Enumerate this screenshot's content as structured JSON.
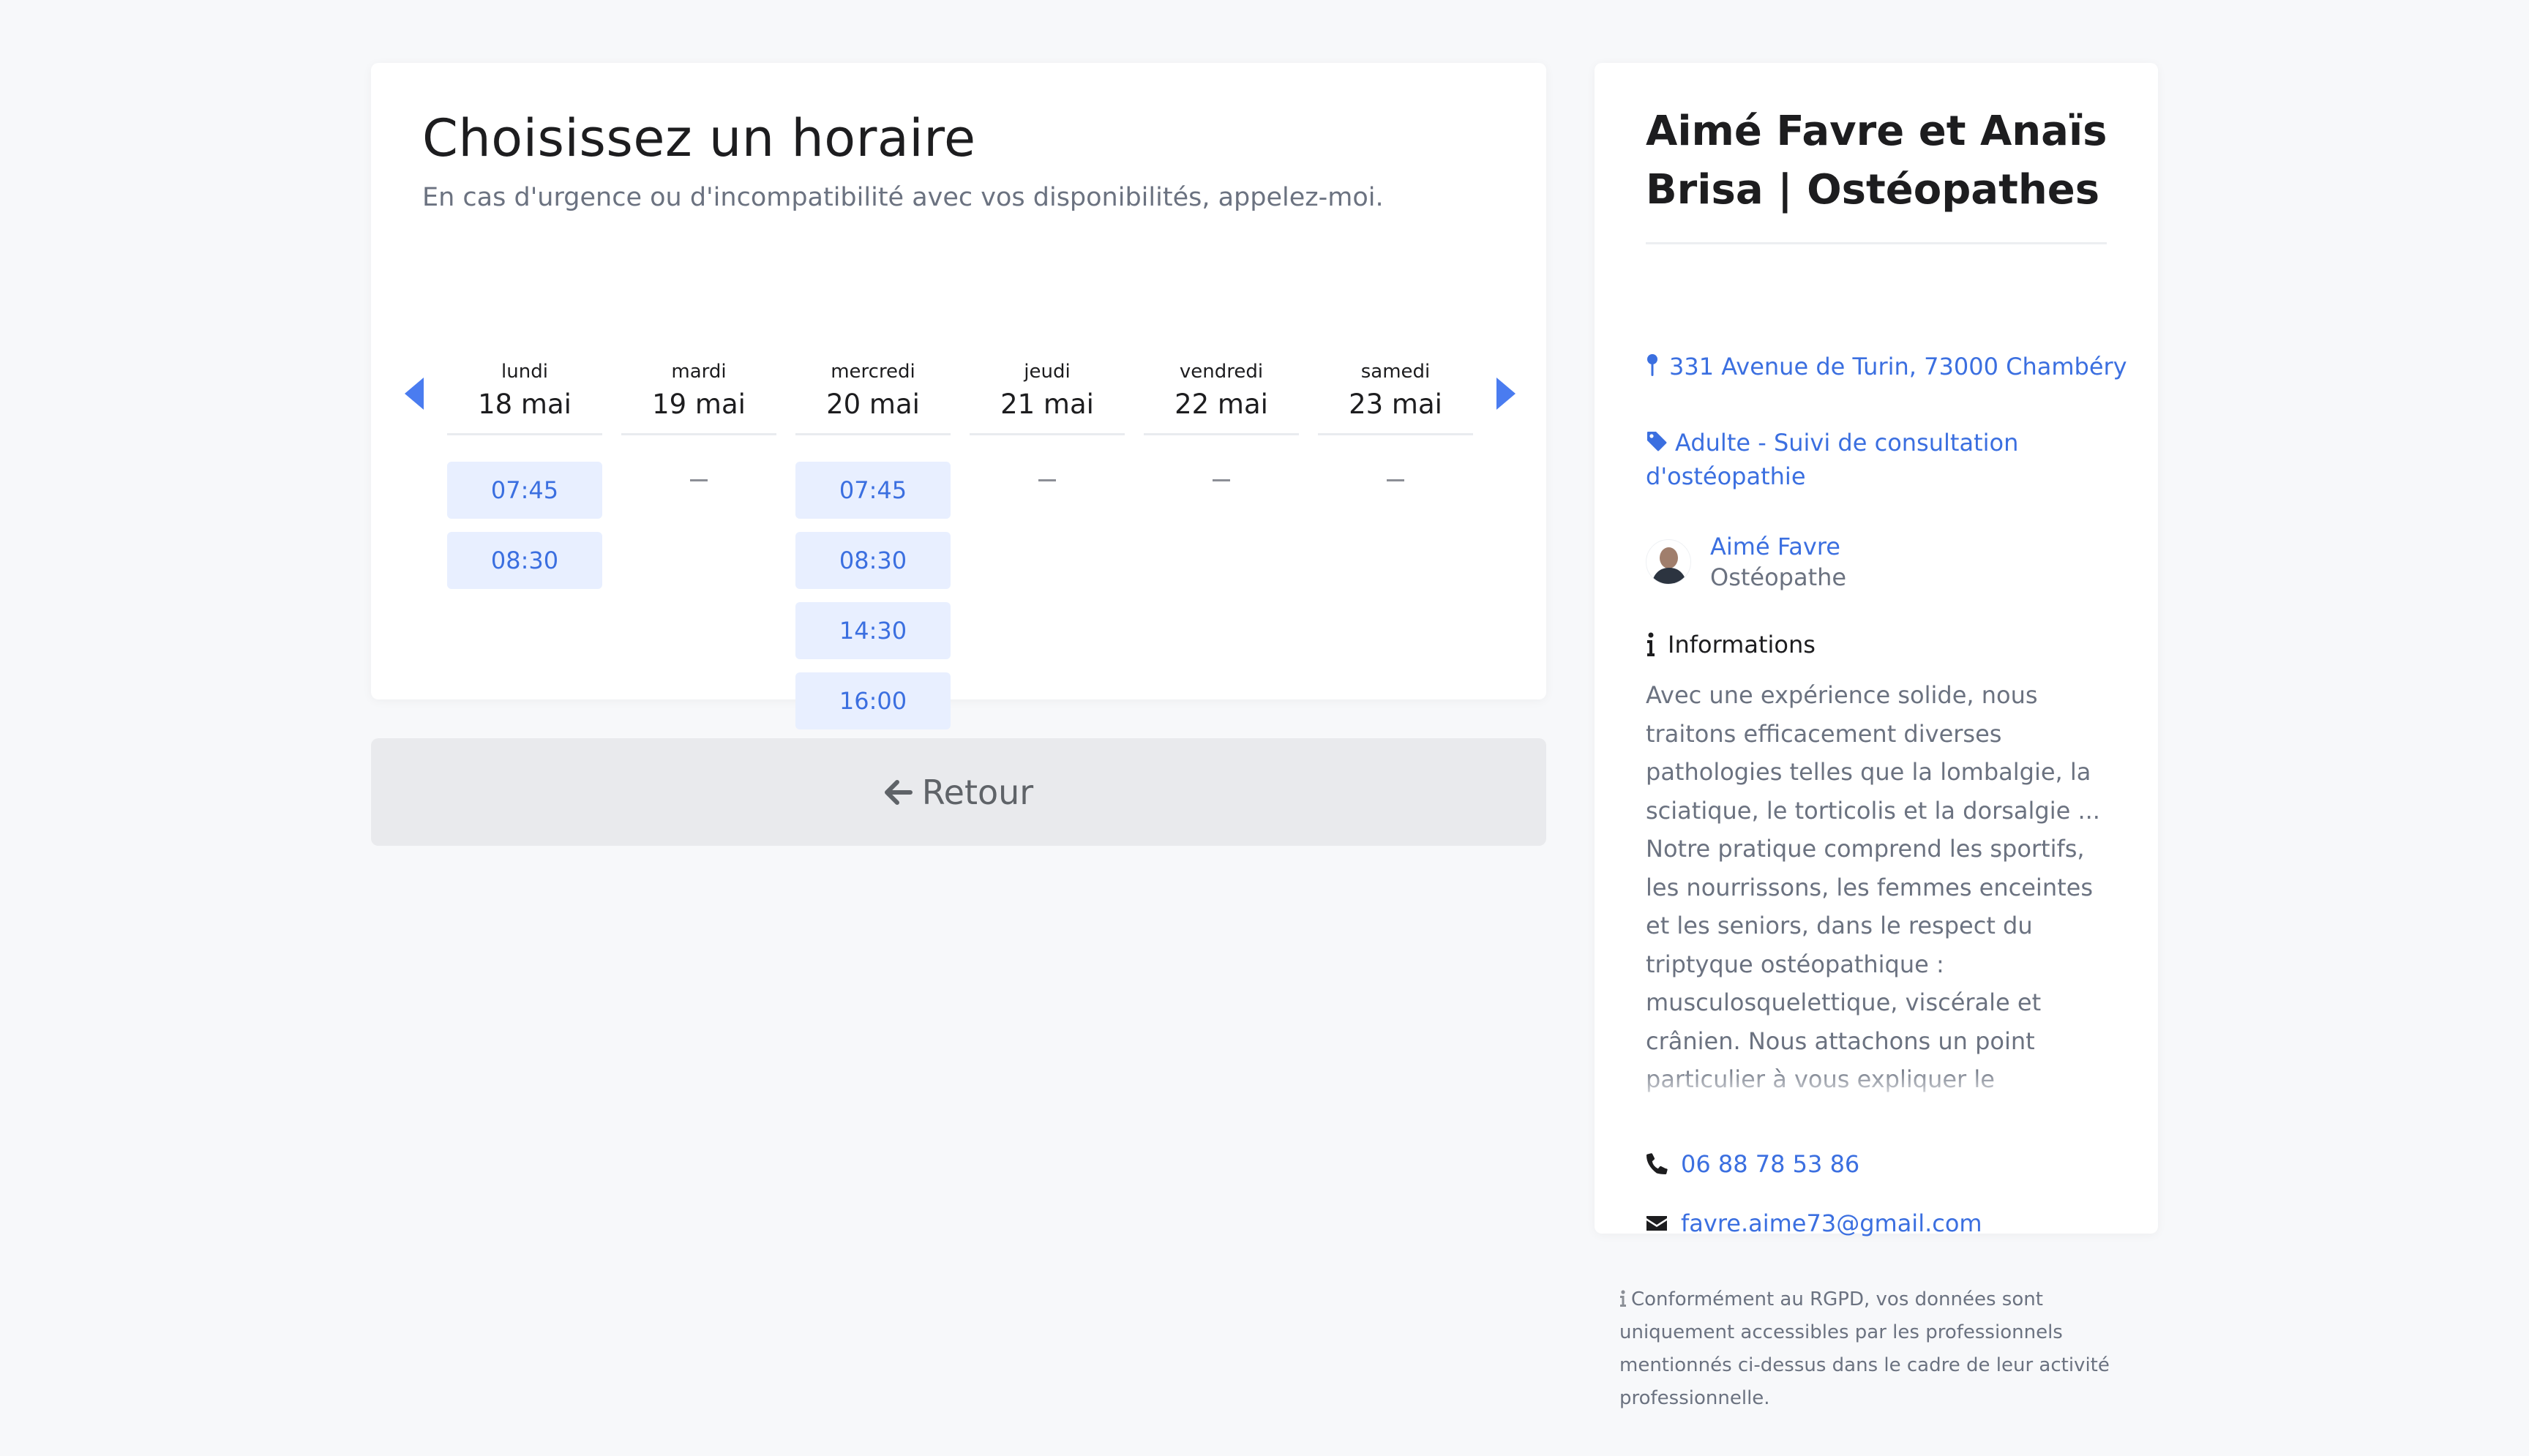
{
  "scheduler": {
    "title": "Choisissez un horaire",
    "subtitle": "En cas d'urgence ou d'incompatibilité avec vos disponibilités, appelez-moi.",
    "prev_icon": "caret-left-icon",
    "next_icon": "caret-right-icon",
    "empty_marker": "—",
    "days": [
      {
        "name": "lundi",
        "date": "18 mai",
        "slots": [
          "07:45",
          "08:30"
        ]
      },
      {
        "name": "mardi",
        "date": "19 mai",
        "slots": []
      },
      {
        "name": "mercredi",
        "date": "20 mai",
        "slots": [
          "07:45",
          "08:30",
          "14:30",
          "16:00"
        ]
      },
      {
        "name": "jeudi",
        "date": "21 mai",
        "slots": []
      },
      {
        "name": "vendredi",
        "date": "22 mai",
        "slots": []
      },
      {
        "name": "samedi",
        "date": "23 mai",
        "slots": []
      }
    ]
  },
  "back_button": {
    "label": "Retour",
    "icon": "arrow-left-icon"
  },
  "practitioner": {
    "title": "Aimé Favre et Anaïs Brisa | Ostéopathes",
    "address": "331 Avenue de Turin, 73000 Chambéry",
    "address_icon": "map-pin-icon",
    "service": "Adulte - Suivi de consultation d'ostéopathie",
    "service_icon": "tag-icon",
    "person": {
      "name": "Aimé Favre",
      "role": "Ostéopathe"
    },
    "info_heading": "Informations",
    "info_icon": "info-icon",
    "info_text": "Avec une expérience solide, nous traitons efficacement diverses pathologies telles que la lombalgie, la sciatique, le torticolis et la dorsalgie ... Notre pratique comprend les sportifs, les nourrissons, les femmes enceintes et les seniors, dans le respect du triptyque ostéopathique : musculosquelettique, viscérale et crânien. Nous attachons un point particulier à vous expliquer le processus pathologique et douloureux",
    "phone": "06 88 78 53 86",
    "phone_icon": "phone-icon",
    "email": "favre.aime73@gmail.com",
    "email_icon": "envelope-icon"
  },
  "rgpd_note": "Conformément au RGPD, vos données sont uniquement accessibles par les professionnels mentionnés ci-dessus dans le cadre de leur activité professionnelle.",
  "colors": {
    "background": "#f7f8fa",
    "accent": "#3b6fe0",
    "arrow": "#4a7cf0",
    "slot_bg": "#e8efff",
    "muted_text": "#6b7280",
    "back_button_bg": "#e9eaed"
  }
}
